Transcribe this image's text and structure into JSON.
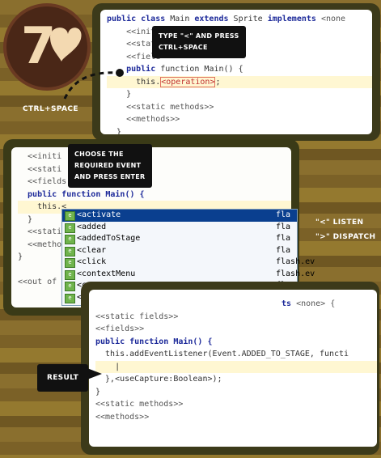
{
  "logo": {
    "glyph": "7",
    "label": "CTRL+SPACE"
  },
  "callouts": {
    "type_hint": [
      "TYPE \"<\" AND PRESS",
      "CTRL+SPACE"
    ],
    "choose_hint": [
      "CHOOSE THE",
      "REQUIRED EVENT",
      "AND PRESS ENTER"
    ],
    "result": "RESULT"
  },
  "legend": {
    "listen": "\"<\" LISTEN",
    "dispatch": "\">\" DISPATCH"
  },
  "panel1": {
    "lines": [
      {
        "kw": "public class",
        "t1": " Main ",
        "kw2": "extends",
        "t2": " Sprite ",
        "kw3": "implements",
        "t3": " <none"
      },
      {
        "t": "    <<initia"
      },
      {
        "t": "    <<stati"
      },
      {
        "t": "    <<field"
      },
      {
        "kw": "public",
        "t": " function Main() {"
      },
      {
        "prefix": "this.",
        "tag": "<operation>",
        "suffix": ";"
      },
      {
        "t": "    }"
      },
      {
        "t": "    <<static methods>>"
      },
      {
        "t": "    <<methods>>"
      },
      {
        "t": "  }"
      },
      {
        "t": "}"
      }
    ]
  },
  "panel2": {
    "lines": [
      "  <<initi",
      "  <<stati",
      "  <<fields",
      "  public function Main() {",
      "    this.<",
      "  }",
      "  <<stati",
      "  <<metho",
      "}",
      "",
      "<<out of"
    ],
    "autocomplete": [
      {
        "name": "<activate",
        "right": "fla"
      },
      {
        "name": "<added",
        "right": "fla"
      },
      {
        "name": "<addedToStage",
        "right": "fla"
      },
      {
        "name": "<clear",
        "right": "fla"
      },
      {
        "name": "<click",
        "right": "flash.ev"
      },
      {
        "name": "<contextMenu",
        "right": "flash.ev"
      },
      {
        "name": "<copy",
        "right": "fla"
      },
      {
        "name": "<cut",
        "right": "fla"
      }
    ]
  },
  "panel3": {
    "lines": [
      "ts <none> {",
      "<<static fields>>",
      "<<fields>>",
      "public function Main() {",
      "  this.addEventListener(Event.ADDED_TO_STAGE, functi",
      "    |",
      "  },<useCapture:Boolean>);",
      "}",
      "<<static methods>>",
      "<<methods>>"
    ]
  },
  "colors": {
    "accent_yellow": "#f1e07a",
    "panel_frame": "#3c3a1a",
    "selection": "#0a3f8f"
  }
}
